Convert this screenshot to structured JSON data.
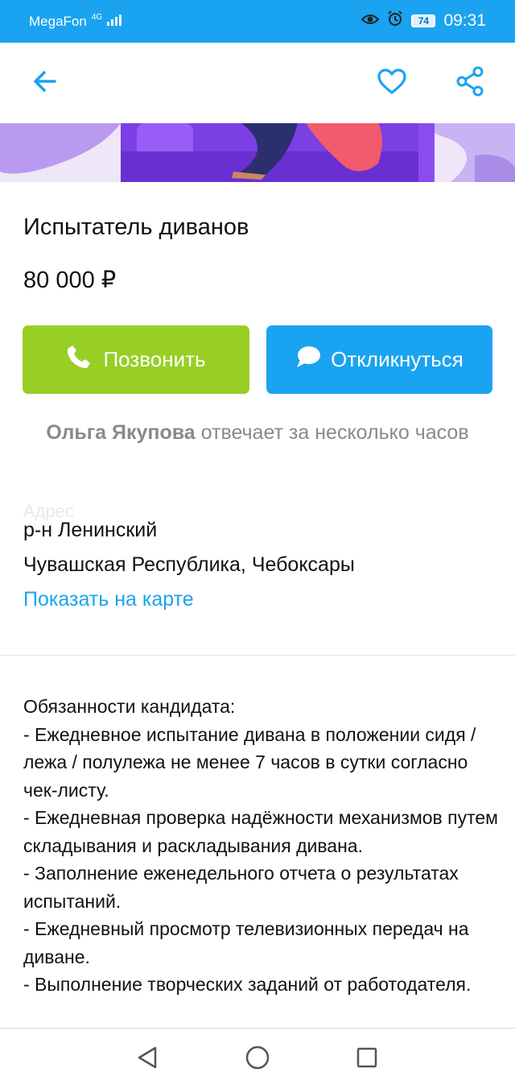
{
  "status_bar": {
    "carrier": "MegaFon",
    "network": "4G",
    "battery": "74",
    "time": "09:31"
  },
  "toolbar": {
    "back_icon": "arrow-left-icon",
    "favorite_icon": "heart-outline-icon",
    "share_icon": "share-icon",
    "accent_color": "#1aa3f0"
  },
  "listing": {
    "title": "Испытатель диванов",
    "price": "80 000 ₽"
  },
  "actions": {
    "call_label": "Позвонить",
    "call_color": "#97cf26",
    "reply_label": "Откликнуться",
    "reply_color": "#1aa3f0"
  },
  "contact": {
    "name": "Ольга Якупова",
    "response_text": "отвечает за несколько часов"
  },
  "address": {
    "faded_label": "Адрес",
    "district": "р-н Ленинский",
    "city": "Чувашская Республика, Чебоксары",
    "map_link": "Показать на карте"
  },
  "description": {
    "lines": [
      "Обязанности кандидата:",
      "- Ежедневное испытание дивана в положении сидя / лежа / полулежа не менее 7 часов в сутки согласно чек-листу.",
      "- Ежедневная проверка надёжности механизмов путем складывания и раскладывания дивана.",
      "- Заполнение еженедельного отчета о результатах испытаний.",
      "- Ежедневный просмотр телевизионных передач на диване.",
      "- Выполнение творческих заданий от работодателя."
    ]
  },
  "nav": {
    "back_icon": "triangle-back-icon",
    "home_icon": "circle-home-icon",
    "recents_icon": "square-recents-icon"
  }
}
